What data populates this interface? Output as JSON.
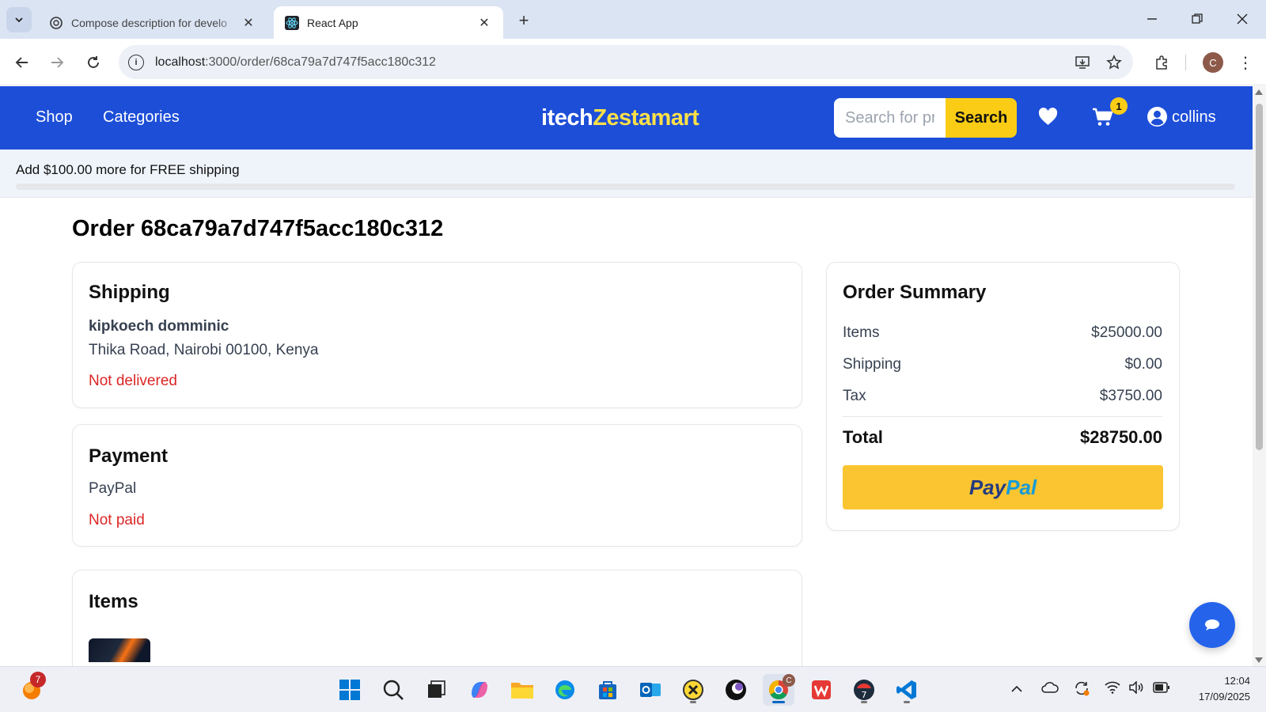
{
  "browser": {
    "tabs": [
      {
        "title": "Compose description for develo",
        "active": false
      },
      {
        "title": "React App",
        "active": true
      }
    ],
    "url_host": "localhost",
    "url_rest": ":3000/order/68ca79a7d747f5acc180c312",
    "profile_initial": "C"
  },
  "header": {
    "nav": {
      "shop": "Shop",
      "categories": "Categories"
    },
    "logo": {
      "part1": "itech",
      "part2": "Zestamart"
    },
    "search": {
      "placeholder": "Search for products...",
      "button": "Search"
    },
    "cart_count": "1",
    "user": "collins",
    "colors": {
      "primary": "#1d4ed8",
      "accent": "#facc15"
    }
  },
  "shipping_banner": {
    "message": "Add $100.00 more for FREE shipping",
    "progress_percent": 0
  },
  "order": {
    "title": "Order 68ca79a7d747f5acc180c312",
    "shipping": {
      "heading": "Shipping",
      "name": "kipkoech domminic",
      "address": "Thika Road, Nairobi 00100, Kenya",
      "status": "Not delivered"
    },
    "payment": {
      "heading": "Payment",
      "method": "PayPal",
      "status": "Not paid"
    },
    "items": {
      "heading": "Items"
    },
    "summary": {
      "heading": "Order Summary",
      "rows": [
        {
          "label": "Items",
          "value": "$25000.00"
        },
        {
          "label": "Shipping",
          "value": "$0.00"
        },
        {
          "label": "Tax",
          "value": "$3750.00"
        }
      ],
      "total_label": "Total",
      "total_value": "$28750.00",
      "paypal": {
        "part1": "Pay",
        "part2": "Pal"
      }
    }
  },
  "taskbar": {
    "weather_badge": "7",
    "chrome_profile_badge": "C",
    "time": "12:04",
    "date": "17/09/2025"
  }
}
